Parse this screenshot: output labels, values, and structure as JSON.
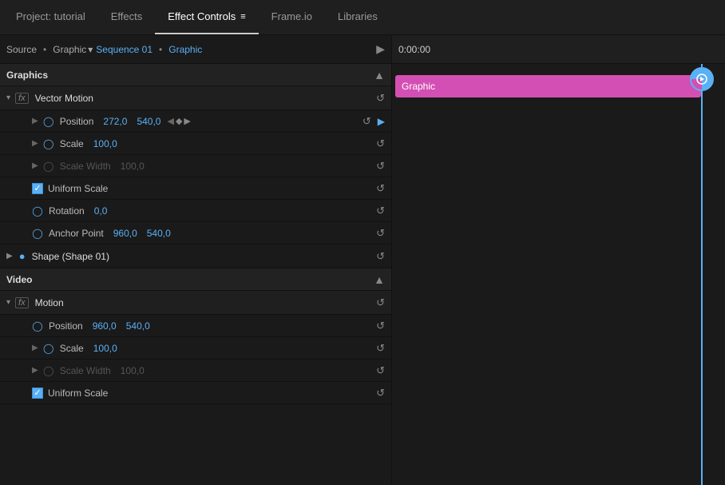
{
  "tabs": [
    {
      "id": "project",
      "label": "Project: tutorial",
      "active": false
    },
    {
      "id": "effects",
      "label": "Effects",
      "active": false
    },
    {
      "id": "effect-controls",
      "label": "Effect Controls",
      "active": true
    },
    {
      "id": "frameio",
      "label": "Frame.io",
      "active": false
    },
    {
      "id": "libraries",
      "label": "Libraries",
      "active": false
    }
  ],
  "source": {
    "label": "Source",
    "dot": "•",
    "name": "Graphic",
    "sequence_label": "Sequence 01",
    "graphic_label": "Graphic",
    "dot2": "•"
  },
  "timecode": "0:00:00",
  "sections": {
    "graphics": {
      "title": "Graphics",
      "effects": [
        {
          "name": "Vector Motion",
          "props": [
            {
              "label": "Position",
              "value1": "272,0",
              "value2": "540,0",
              "has_clock": true,
              "has_toggle": true,
              "has_arrows": true
            },
            {
              "label": "Scale",
              "value1": "100,0",
              "has_clock": true,
              "has_toggle": true
            },
            {
              "label": "Scale Width",
              "value1": "100,0",
              "has_clock": false,
              "has_toggle": true,
              "disabled": true
            },
            {
              "label": "Rotation",
              "value1": "0,0",
              "has_clock": true,
              "has_toggle": false
            },
            {
              "label": "Anchor Point",
              "value1": "960,0",
              "value2": "540,0",
              "has_clock": true,
              "has_toggle": false
            }
          ],
          "has_uniform_scale": true
        },
        {
          "name": "Shape (Shape 01)",
          "is_shape": true
        }
      ]
    },
    "video": {
      "title": "Video",
      "effects": [
        {
          "name": "Motion",
          "props": [
            {
              "label": "Position",
              "value1": "960,0",
              "value2": "540,0",
              "has_clock": true,
              "has_toggle": false
            },
            {
              "label": "Scale",
              "value1": "100,0",
              "has_clock": true,
              "has_toggle": true
            },
            {
              "label": "Scale Width",
              "value1": "100,0",
              "has_clock": false,
              "has_toggle": true,
              "disabled": true
            }
          ],
          "has_uniform_scale": true
        }
      ]
    }
  },
  "graphic_bar_label": "Graphic",
  "buttons": {
    "panel_menu": "≡",
    "play": "▶",
    "reset": "↺"
  }
}
